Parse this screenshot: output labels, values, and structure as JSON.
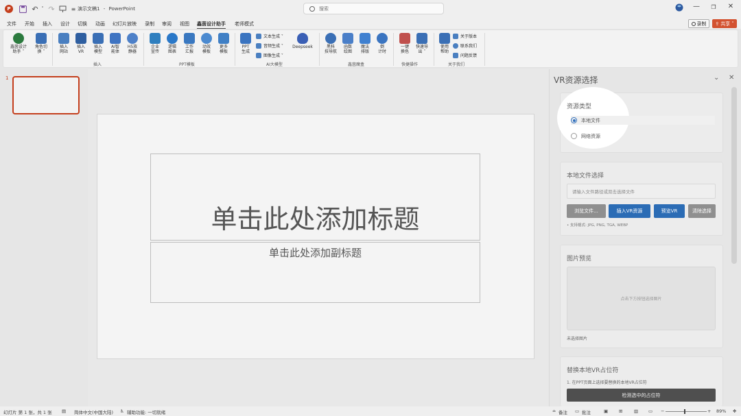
{
  "titlebar": {
    "doc_title": "演示文稿1",
    "separator": "-",
    "app_name": "PowerPoint",
    "search_placeholder": "搜索",
    "min": "—",
    "restore": "❐",
    "close": "✕"
  },
  "menu": {
    "tabs": [
      "文件",
      "开始",
      "插入",
      "设计",
      "切换",
      "动画",
      "幻灯片放映",
      "录制",
      "审阅",
      "视图",
      "鑫茵设计助手",
      "老师模式"
    ],
    "active_index": 10,
    "record_label": "录制",
    "share_label": "共享"
  },
  "ribbon": {
    "buttons": [
      {
        "label": "鑫茵设计\n助手 ˅",
        "color": "#2b7a3e"
      },
      {
        "label": "角色切\n换 ˅",
        "color": "#3a6fb5"
      },
      {
        "label": "插入\n网站",
        "color": "#3a6fb5"
      },
      {
        "label": "插入\nVR",
        "color": "#3a6fb5"
      },
      {
        "label": "插入\n模型",
        "color": "#3a6fb5"
      },
      {
        "label": "AI智\n能体",
        "color": "#3a6fb5"
      },
      {
        "label": "H5族\n静器",
        "color": "#3a6fb5"
      },
      {
        "label": "企业\n宣传",
        "color": "#2f7fbf"
      },
      {
        "label": "逻辑\n图表",
        "color": "#2f7fbf"
      },
      {
        "label": "工作\n汇报",
        "color": "#2f7fbf"
      },
      {
        "label": "动效\n模板",
        "color": "#2f7fbf"
      },
      {
        "label": "更多\n模板",
        "color": "#2f7fbf"
      },
      {
        "label": "PPT\n生成",
        "color": "#2f7fbf"
      },
      {
        "label": "Deepseek",
        "color": "#3a5fb5"
      },
      {
        "label": "黑科\n技导航",
        "color": "#3a6fb5"
      },
      {
        "label": "函数\n绘图",
        "color": "#3a6fb5"
      },
      {
        "label": "魔法\n排版",
        "color": "#3a6fb5"
      },
      {
        "label": "倒\n计时",
        "color": "#3a6fb5"
      },
      {
        "label": "一键\n换色",
        "color": "#c0504d"
      },
      {
        "label": "快速导\n出 ˅",
        "color": "#3a6fb5"
      },
      {
        "label": "使用\n帮助",
        "color": "#3a6fb5"
      }
    ],
    "ai_small": [
      "文本生成 ˅",
      "音频生成 ˅",
      "图像生成 ˅"
    ],
    "about_small": [
      "关于版本",
      "联系我们",
      "问题反馈"
    ],
    "groups": [
      "插入",
      "PPT模板",
      "AI大模型",
      "鑫茵魔盒",
      "快捷操作",
      "关于我们"
    ]
  },
  "thumbs": {
    "slide_number": "1"
  },
  "slide": {
    "title_placeholder": "单击此处添加标题",
    "subtitle_placeholder": "单击此处添加副标题"
  },
  "pane": {
    "title": "VR资源选择",
    "resource_type_title": "资源类型",
    "options": [
      "本地文件",
      "网络资源"
    ],
    "selected_option": "本地文件",
    "local_title": "本地文件选择",
    "path_placeholder": "请输入文件路径或双击选择文件",
    "buttons": [
      "浏览文件...",
      "插入VR资源",
      "预览VR",
      "清除选择"
    ],
    "format_note": "• 支持格式: JPG, PNG, TGA, WEBP",
    "preview_title": "图片预览",
    "preview_hint": "点击下方按钮选择图片",
    "no_image": "未选择图片",
    "replace_title": "替换本地VR占位符",
    "replace_step": "1. 在PPT页面上选择要替换的本地VR占位符",
    "detect_button": "检测选中的占位符"
  },
  "status": {
    "slide_info": "幻灯片 第 1 张，共 1 张",
    "language": "简体中文(中国大陆)",
    "accessibility": "辅助功能: 一切就绪",
    "notes": "备注",
    "comments": "批注",
    "zoom": "89%"
  }
}
